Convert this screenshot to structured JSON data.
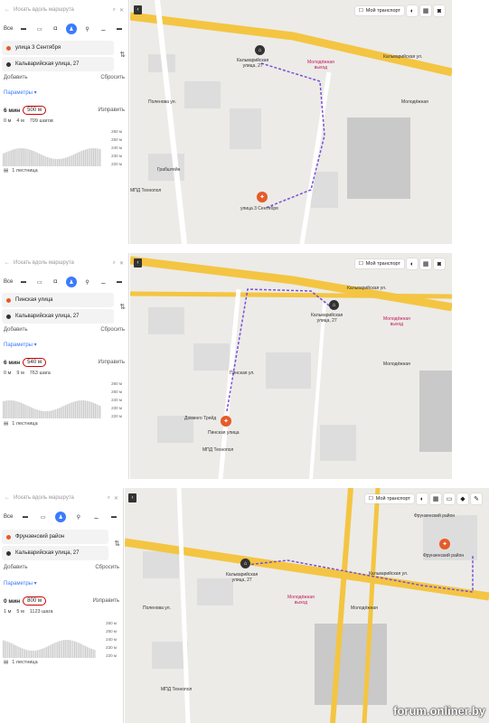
{
  "screenshots": [
    {
      "search_placeholder": "Искать вдоль маршрута",
      "mode_all": "Все",
      "from": "улица 3 Сентября",
      "to": "Кальварийская улица, 27",
      "add": "Добавить",
      "reset": "Сбросить",
      "params": "Параметры ▾",
      "time": "6 мин",
      "distance": "500 м",
      "show": "Изправить",
      "up": "0 м",
      "down": "4 м",
      "steps": "709 шагов",
      "ticks": [
        "260 м",
        "250 м",
        "240 м",
        "230 м",
        "220 м"
      ],
      "ladder": "1 лестница",
      "my_transport": "Мой транспорт",
      "dest_label": "Кальварийская\nулица, 27",
      "start_label": "улица 3 Сентября",
      "metro": "Молодёжная\nвыход",
      "labels": [
        "Кальварийская ул.",
        "Молодёжная",
        "Поленова ул.",
        "Грабштейн",
        "МПД Технопол"
      ]
    },
    {
      "search_placeholder": "Искать вдоль маршрута",
      "mode_all": "Все",
      "from": "Пинская улица",
      "to": "Кальварийская улица, 27",
      "add": "Добавить",
      "reset": "Сбросить",
      "params": "Параметры ▾",
      "time": "6 мин",
      "distance": "540 м",
      "show": "Изправить",
      "up": "0 м",
      "down": "9 м",
      "steps": "763 шага",
      "ticks": [
        "260 м",
        "250 м",
        "240 м",
        "230 м",
        "220 м"
      ],
      "ladder": "1 лестница",
      "my_transport": "Мой транспорт",
      "dest_label": "Кальварийская\nулица, 27",
      "start_label": "Пинская улица",
      "metro": "Молодёжная\nвыход",
      "labels": [
        "Кальварийская ул.",
        "Молодёжная",
        "Пинская ул.",
        "Доминго Трейд",
        "МПД Технопол"
      ]
    },
    {
      "search_placeholder": "Искать вдоль маршрута",
      "mode_all": "Все",
      "from": "Фрунзенский район",
      "to": "Кальварийская улица, 27",
      "add": "Добавить",
      "reset": "Сбросить",
      "params": "Параметры ▾",
      "time": "0 мин",
      "distance": "800 м",
      "show": "Изправить",
      "up": "1 м",
      "down": "5 м",
      "steps": "1123 шага",
      "ticks": [
        "260 м",
        "250 м",
        "240 м",
        "230 м",
        "220 м"
      ],
      "ladder": "1 лестница",
      "my_transport": "Мой транспорт",
      "dest_label": "Кальварийская\nулица, 27",
      "start_label": "Фрунзенский район",
      "metro": "Молодёжная\nвыход",
      "labels": [
        "Кальварийская ул.",
        "Молодёжная",
        "Поленова ул.",
        "Фрунзенский район",
        "МПД Технопол"
      ]
    }
  ],
  "watermark": "forum.onliner.by",
  "colors": {
    "accent": "#3a7bfd",
    "route": "#7a4fd8",
    "road": "#f4c542",
    "pin": "#e65a2a",
    "circle": "#cc0000"
  }
}
